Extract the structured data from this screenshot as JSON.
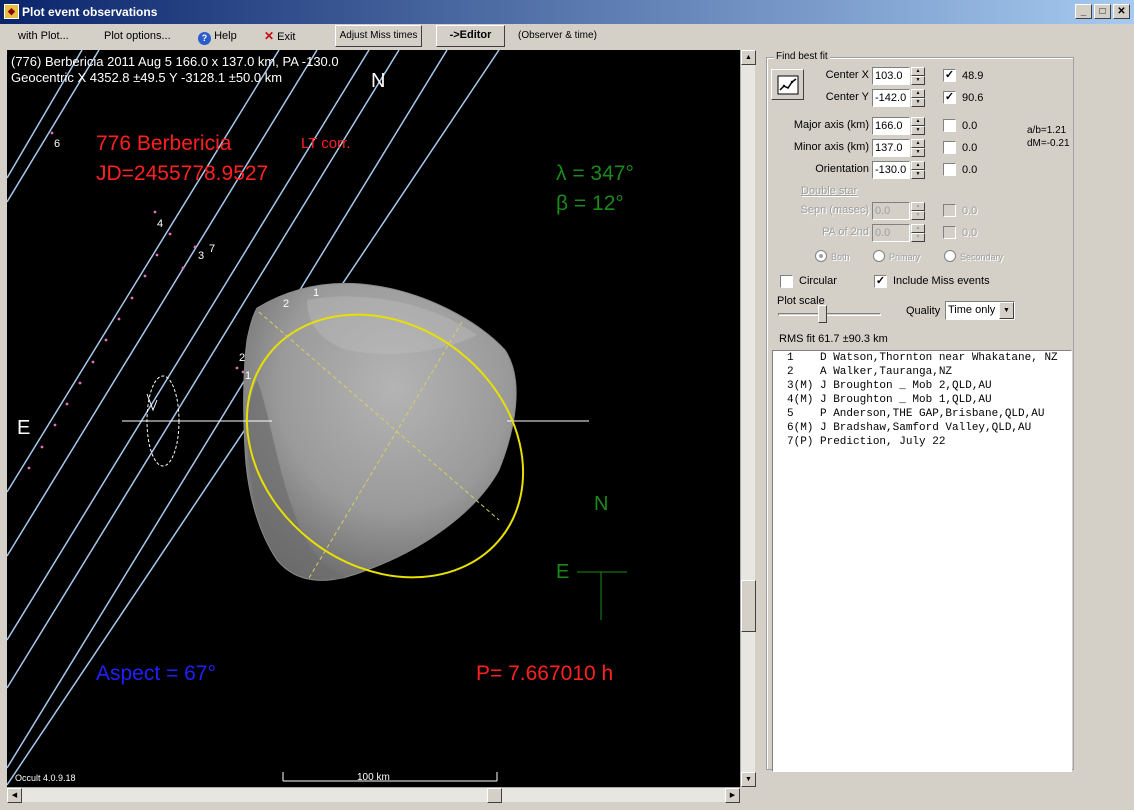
{
  "window": {
    "title": "Plot event observations",
    "buttons": [
      "_",
      "□",
      "✕"
    ]
  },
  "toolbar": {
    "with_plot": "with Plot...",
    "plot_options": "Plot options...",
    "help": "Help",
    "exit": "Exit",
    "adjust_miss": "Adjust Miss times",
    "editor": "->Editor",
    "observer_time": "(Observer & time)"
  },
  "plot": {
    "header1": "(776) Berbericia  2011 Aug 5   166.0 x 137.0 km, PA -130.0",
    "header2": "Geocentric X  4352.8 ±49.5  Y -3128.1 ±50.0 km",
    "north_top": "N",
    "east_left": "E",
    "asteroid_name": "776 Berbericia",
    "lt_corr": "LT corr.",
    "jd": "JD=2455778.9527",
    "lambda": "λ =  347°",
    "beta": "β =   12°",
    "aspect": "Aspect = 67°",
    "period": "P= 7.667010 h",
    "version": "Occult 4.0.9.18",
    "scale": "100 km",
    "compass_n": "N",
    "compass_e": "E",
    "chord_labels": [
      "6",
      "4",
      "7",
      "3",
      "2",
      "1",
      "2",
      "1"
    ]
  },
  "panel": {
    "group_title": "Find best fit",
    "rows": [
      {
        "label": "Center X",
        "value": "103.0",
        "checked": true,
        "result": "48.9"
      },
      {
        "label": "Center Y",
        "value": "-142.0",
        "checked": true,
        "result": "90.6"
      },
      {
        "label": "Major axis (km)",
        "value": "166.0",
        "checked": false,
        "result": "0.0"
      },
      {
        "label": "Minor axis (km)",
        "value": "137.0",
        "checked": false,
        "result": "0.0"
      },
      {
        "label": "Orientation",
        "value": "-130.0",
        "checked": false,
        "result": "0.0"
      }
    ],
    "ab_ratio": "a/b=1.21",
    "dm": "dM=-0.21",
    "double_star": "Double star",
    "ds_rows": [
      {
        "label": "Sepn (masec)",
        "value": "0.0",
        "result": "0.0"
      },
      {
        "label": "PA of 2nd",
        "value": "0.0",
        "result": "0.0"
      }
    ],
    "radio_both": "Both",
    "radio_primary": "Primary",
    "radio_secondary": "Secondary",
    "circular": "Circular",
    "include_miss": "Include Miss events",
    "plot_scale": "Plot scale",
    "quality_label": "Quality",
    "quality_value": "Time only",
    "rms_fit": "RMS fit 61.7 ±90.3 km"
  },
  "observers": [
    "1    D Watson,Thornton near Whakatane, NZ",
    "2    A Walker,Tauranga,NZ",
    "3(M) J Broughton _ Mob 2,QLD,AU",
    "4(M) J Broughton _ Mob 1,QLD,AU",
    "5    P Anderson,THE GAP,Brisbane,QLD,AU",
    "6(M) J Bradshaw,Samford Valley,QLD,AU",
    "7(P) Prediction, July 22"
  ],
  "colors": {
    "red": "#ff2020",
    "green": "#1a8a1a",
    "blue": "#2020ff",
    "yellow": "#e8e000",
    "chord": "#a8c8ec"
  }
}
